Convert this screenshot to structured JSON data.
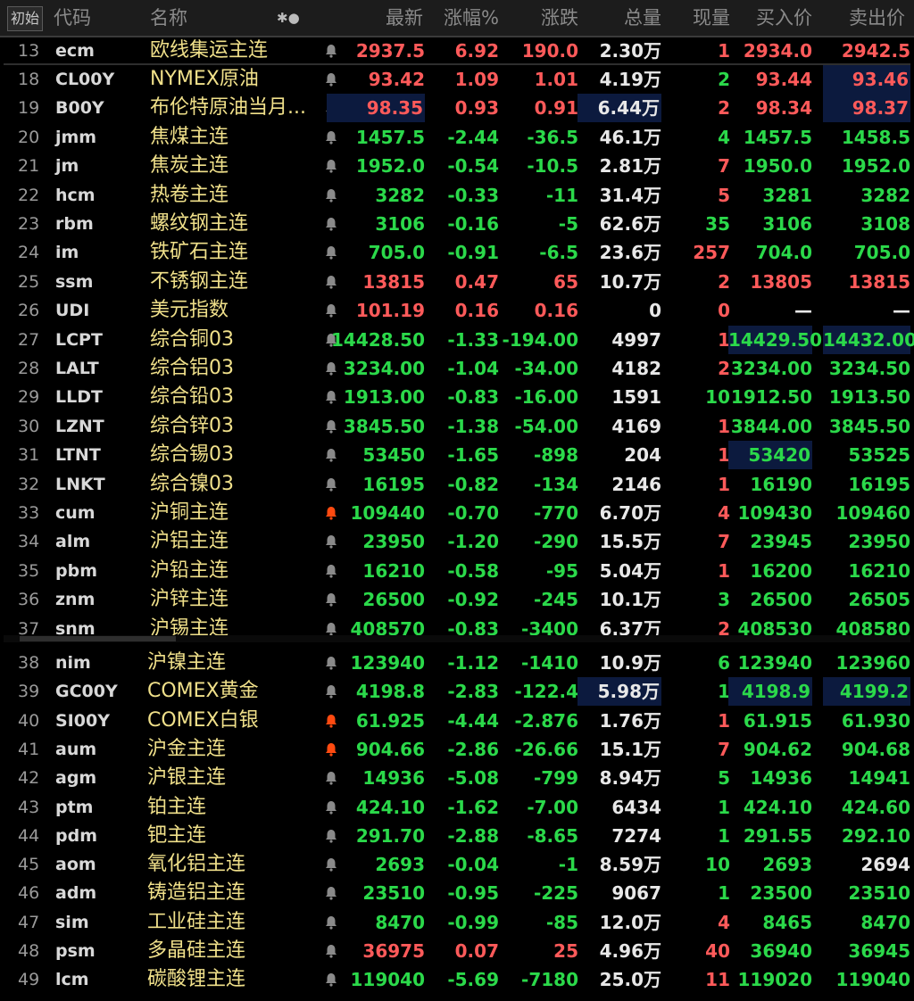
{
  "header": {
    "init_label": "初始",
    "columns": [
      "代码",
      "名称",
      "✱●",
      "最新",
      "涨幅%",
      "涨跌",
      "总量",
      "现量",
      "买入价",
      "卖出价"
    ]
  },
  "colors": {
    "up": "#ff5a5a",
    "down": "#2bd94a",
    "name": "#f0e08a",
    "alert_active": "#ff4a10",
    "alert_idle": "#8a8a8a"
  },
  "rows": [
    {
      "idx": "13",
      "code": "ecm",
      "name": "欧线集运主连",
      "alert": "idle",
      "last": "2937.5",
      "pct": "6.92",
      "chg": "190.0",
      "vol": "2.30万",
      "cur": "1",
      "bid": "2934.0",
      "ask": "2942.5",
      "dir": "up",
      "cur_dir": "up",
      "bid_dir": "up",
      "ask_dir": "up",
      "hl": []
    },
    {
      "idx": "18",
      "code": "CL00Y",
      "name": "NYMEX原油",
      "alert": "idle",
      "last": "93.42",
      "pct": "1.09",
      "chg": "1.01",
      "vol": "4.19万",
      "cur": "2",
      "bid": "93.44",
      "ask": "93.46",
      "dir": "up",
      "cur_dir": "dn",
      "bid_dir": "up",
      "ask_dir": "up",
      "hl": [
        "ask"
      ]
    },
    {
      "idx": "19",
      "code": "B00Y",
      "name": "布伦特原油当月...",
      "alert": "idle",
      "last": "98.35",
      "pct": "0.93",
      "chg": "0.91",
      "vol": "6.44万",
      "cur": "2",
      "bid": "98.34",
      "ask": "98.37",
      "dir": "up",
      "cur_dir": "up",
      "bid_dir": "up",
      "ask_dir": "up",
      "hl": [
        "last",
        "vol",
        "ask"
      ]
    },
    {
      "idx": "20",
      "code": "jmm",
      "name": "焦煤主连",
      "alert": "idle",
      "last": "1457.5",
      "pct": "-2.44",
      "chg": "-36.5",
      "vol": "46.1万",
      "cur": "4",
      "bid": "1457.5",
      "ask": "1458.5",
      "dir": "dn",
      "cur_dir": "dn",
      "bid_dir": "dn",
      "ask_dir": "dn",
      "hl": []
    },
    {
      "idx": "21",
      "code": "jm",
      "name": "焦炭主连",
      "alert": "idle",
      "last": "1952.0",
      "pct": "-0.54",
      "chg": "-10.5",
      "vol": "2.81万",
      "cur": "7",
      "bid": "1950.0",
      "ask": "1952.0",
      "dir": "dn",
      "cur_dir": "up",
      "bid_dir": "dn",
      "ask_dir": "dn",
      "hl": []
    },
    {
      "idx": "22",
      "code": "hcm",
      "name": "热卷主连",
      "alert": "idle",
      "last": "3282",
      "pct": "-0.33",
      "chg": "-11",
      "vol": "31.4万",
      "cur": "5",
      "bid": "3281",
      "ask": "3282",
      "dir": "dn",
      "cur_dir": "up",
      "bid_dir": "dn",
      "ask_dir": "dn",
      "hl": []
    },
    {
      "idx": "23",
      "code": "rbm",
      "name": "螺纹钢主连",
      "alert": "idle",
      "last": "3106",
      "pct": "-0.16",
      "chg": "-5",
      "vol": "62.6万",
      "cur": "35",
      "bid": "3106",
      "ask": "3108",
      "dir": "dn",
      "cur_dir": "dn",
      "bid_dir": "dn",
      "ask_dir": "dn",
      "hl": []
    },
    {
      "idx": "24",
      "code": "im",
      "name": "铁矿石主连",
      "alert": "idle",
      "last": "705.0",
      "pct": "-0.91",
      "chg": "-6.5",
      "vol": "23.6万",
      "cur": "257",
      "bid": "704.0",
      "ask": "705.0",
      "dir": "dn",
      "cur_dir": "up",
      "bid_dir": "dn",
      "ask_dir": "dn",
      "hl": []
    },
    {
      "idx": "25",
      "code": "ssm",
      "name": "不锈钢主连",
      "alert": "idle",
      "last": "13815",
      "pct": "0.47",
      "chg": "65",
      "vol": "10.7万",
      "cur": "2",
      "bid": "13805",
      "ask": "13815",
      "dir": "up",
      "cur_dir": "up",
      "bid_dir": "up",
      "ask_dir": "up",
      "hl": []
    },
    {
      "idx": "26",
      "code": "UDI",
      "name": "美元指数",
      "alert": "idle",
      "last": "101.19",
      "pct": "0.16",
      "chg": "0.16",
      "vol": "0",
      "cur": "0",
      "bid": "—",
      "ask": "—",
      "dir": "up",
      "cur_dir": "up",
      "bid_dir": "ne",
      "ask_dir": "ne",
      "hl": []
    },
    {
      "idx": "27",
      "code": "LCPT",
      "name": "综合铜03",
      "alert": "idle",
      "last": "14428.50",
      "pct": "-1.33",
      "chg": "-194.00",
      "vol": "4997",
      "cur": "1",
      "bid": "14429.50",
      "ask": "14432.00",
      "dir": "dn",
      "cur_dir": "up",
      "bid_dir": "dn",
      "ask_dir": "dn",
      "hl": [
        "bid",
        "ask"
      ]
    },
    {
      "idx": "28",
      "code": "LALT",
      "name": "综合铝03",
      "alert": "idle",
      "last": "3234.00",
      "pct": "-1.04",
      "chg": "-34.00",
      "vol": "4182",
      "cur": "2",
      "bid": "3234.00",
      "ask": "3234.50",
      "dir": "dn",
      "cur_dir": "up",
      "bid_dir": "dn",
      "ask_dir": "dn",
      "hl": []
    },
    {
      "idx": "29",
      "code": "LLDT",
      "name": "综合铅03",
      "alert": "idle",
      "last": "1913.00",
      "pct": "-0.83",
      "chg": "-16.00",
      "vol": "1591",
      "cur": "10",
      "bid": "1912.50",
      "ask": "1913.50",
      "dir": "dn",
      "cur_dir": "dn",
      "bid_dir": "dn",
      "ask_dir": "dn",
      "hl": []
    },
    {
      "idx": "30",
      "code": "LZNT",
      "name": "综合锌03",
      "alert": "idle",
      "last": "3845.50",
      "pct": "-1.38",
      "chg": "-54.00",
      "vol": "4169",
      "cur": "1",
      "bid": "3844.00",
      "ask": "3845.50",
      "dir": "dn",
      "cur_dir": "up",
      "bid_dir": "dn",
      "ask_dir": "dn",
      "hl": []
    },
    {
      "idx": "31",
      "code": "LTNT",
      "name": "综合锡03",
      "alert": "idle",
      "last": "53450",
      "pct": "-1.65",
      "chg": "-898",
      "vol": "204",
      "cur": "1",
      "bid": "53420",
      "ask": "53525",
      "dir": "dn",
      "cur_dir": "up",
      "bid_dir": "dn",
      "ask_dir": "dn",
      "hl": [
        "bid"
      ]
    },
    {
      "idx": "32",
      "code": "LNKT",
      "name": "综合镍03",
      "alert": "idle",
      "last": "16195",
      "pct": "-0.82",
      "chg": "-134",
      "vol": "2146",
      "cur": "1",
      "bid": "16190",
      "ask": "16195",
      "dir": "dn",
      "cur_dir": "up",
      "bid_dir": "dn",
      "ask_dir": "dn",
      "hl": []
    },
    {
      "idx": "33",
      "code": "cum",
      "name": "沪铜主连",
      "alert": "active",
      "last": "109440",
      "pct": "-0.70",
      "chg": "-770",
      "vol": "6.70万",
      "cur": "4",
      "bid": "109430",
      "ask": "109460",
      "dir": "dn",
      "cur_dir": "up",
      "bid_dir": "dn",
      "ask_dir": "dn",
      "hl": []
    },
    {
      "idx": "34",
      "code": "alm",
      "name": "沪铝主连",
      "alert": "idle",
      "last": "23950",
      "pct": "-1.20",
      "chg": "-290",
      "vol": "15.5万",
      "cur": "7",
      "bid": "23945",
      "ask": "23950",
      "dir": "dn",
      "cur_dir": "up",
      "bid_dir": "dn",
      "ask_dir": "dn",
      "hl": []
    },
    {
      "idx": "35",
      "code": "pbm",
      "name": "沪铅主连",
      "alert": "idle",
      "last": "16210",
      "pct": "-0.58",
      "chg": "-95",
      "vol": "5.04万",
      "cur": "1",
      "bid": "16200",
      "ask": "16210",
      "dir": "dn",
      "cur_dir": "up",
      "bid_dir": "dn",
      "ask_dir": "dn",
      "hl": []
    },
    {
      "idx": "36",
      "code": "znm",
      "name": "沪锌主连",
      "alert": "idle",
      "last": "26500",
      "pct": "-0.92",
      "chg": "-245",
      "vol": "10.1万",
      "cur": "3",
      "bid": "26500",
      "ask": "26505",
      "dir": "dn",
      "cur_dir": "dn",
      "bid_dir": "dn",
      "ask_dir": "dn",
      "hl": []
    },
    {
      "idx": "37",
      "code": "snm",
      "name": "沪锡主连",
      "alert": "idle",
      "last": "408570",
      "pct": "-0.83",
      "chg": "-3400",
      "vol": "6.37万",
      "cur": "2",
      "bid": "408530",
      "ask": "408580",
      "dir": "dn",
      "cur_dir": "up",
      "bid_dir": "dn",
      "ask_dir": "dn",
      "hl": []
    },
    {
      "idx": "38",
      "code": "nim",
      "name": "沪镍主连",
      "alert": "idle",
      "last": "123940",
      "pct": "-1.12",
      "chg": "-1410",
      "vol": "10.9万",
      "cur": "6",
      "bid": "123940",
      "ask": "123960",
      "dir": "dn",
      "cur_dir": "dn",
      "bid_dir": "dn",
      "ask_dir": "dn",
      "hl": []
    },
    {
      "idx": "39",
      "code": "GC00Y",
      "name": "COMEX黄金",
      "alert": "idle",
      "last": "4198.8",
      "pct": "-2.83",
      "chg": "-122.4",
      "vol": "5.98万",
      "cur": "1",
      "bid": "4198.9",
      "ask": "4199.2",
      "dir": "dn",
      "cur_dir": "dn",
      "bid_dir": "dn",
      "ask_dir": "dn",
      "hl": [
        "vol",
        "bid",
        "ask"
      ]
    },
    {
      "idx": "40",
      "code": "SI00Y",
      "name": "COMEX白银",
      "alert": "active",
      "last": "61.925",
      "pct": "-4.44",
      "chg": "-2.876",
      "vol": "1.76万",
      "cur": "1",
      "bid": "61.915",
      "ask": "61.930",
      "dir": "dn",
      "cur_dir": "up",
      "bid_dir": "dn",
      "ask_dir": "dn",
      "hl": []
    },
    {
      "idx": "41",
      "code": "aum",
      "name": "沪金主连",
      "alert": "active",
      "last": "904.66",
      "pct": "-2.86",
      "chg": "-26.66",
      "vol": "15.1万",
      "cur": "7",
      "bid": "904.62",
      "ask": "904.68",
      "dir": "dn",
      "cur_dir": "up",
      "bid_dir": "dn",
      "ask_dir": "dn",
      "hl": []
    },
    {
      "idx": "42",
      "code": "agm",
      "name": "沪银主连",
      "alert": "idle",
      "last": "14936",
      "pct": "-5.08",
      "chg": "-799",
      "vol": "8.94万",
      "cur": "5",
      "bid": "14936",
      "ask": "14941",
      "dir": "dn",
      "cur_dir": "dn",
      "bid_dir": "dn",
      "ask_dir": "dn",
      "hl": []
    },
    {
      "idx": "43",
      "code": "ptm",
      "name": "铂主连",
      "alert": "idle",
      "last": "424.10",
      "pct": "-1.62",
      "chg": "-7.00",
      "vol": "6434",
      "cur": "1",
      "bid": "424.10",
      "ask": "424.60",
      "dir": "dn",
      "cur_dir": "dn",
      "bid_dir": "dn",
      "ask_dir": "dn",
      "hl": []
    },
    {
      "idx": "44",
      "code": "pdm",
      "name": "钯主连",
      "alert": "idle",
      "last": "291.70",
      "pct": "-2.88",
      "chg": "-8.65",
      "vol": "7274",
      "cur": "1",
      "bid": "291.55",
      "ask": "292.10",
      "dir": "dn",
      "cur_dir": "dn",
      "bid_dir": "dn",
      "ask_dir": "dn",
      "hl": []
    },
    {
      "idx": "45",
      "code": "aom",
      "name": "氧化铝主连",
      "alert": "idle",
      "last": "2693",
      "pct": "-0.04",
      "chg": "-1",
      "vol": "8.59万",
      "cur": "10",
      "bid": "2693",
      "ask": "2694",
      "dir": "dn",
      "cur_dir": "dn",
      "bid_dir": "dn",
      "ask_dir": "ne",
      "hl": []
    },
    {
      "idx": "46",
      "code": "adm",
      "name": "铸造铝主连",
      "alert": "idle",
      "last": "23510",
      "pct": "-0.95",
      "chg": "-225",
      "vol": "9067",
      "cur": "1",
      "bid": "23500",
      "ask": "23510",
      "dir": "dn",
      "cur_dir": "dn",
      "bid_dir": "dn",
      "ask_dir": "dn",
      "hl": []
    },
    {
      "idx": "47",
      "code": "sim",
      "name": "工业硅主连",
      "alert": "idle",
      "last": "8470",
      "pct": "-0.99",
      "chg": "-85",
      "vol": "12.0万",
      "cur": "4",
      "bid": "8465",
      "ask": "8470",
      "dir": "dn",
      "cur_dir": "up",
      "bid_dir": "dn",
      "ask_dir": "dn",
      "hl": []
    },
    {
      "idx": "48",
      "code": "psm",
      "name": "多晶硅主连",
      "alert": "idle",
      "last": "36975",
      "pct": "0.07",
      "chg": "25",
      "vol": "4.96万",
      "cur": "40",
      "bid": "36940",
      "ask": "36945",
      "dir": "up",
      "cur_dir": "up",
      "bid_dir": "dn",
      "ask_dir": "dn",
      "hl": []
    },
    {
      "idx": "49",
      "code": "lcm",
      "name": "碳酸锂主连",
      "alert": "idle",
      "last": "119040",
      "pct": "-5.69",
      "chg": "-7180",
      "vol": "25.0万",
      "cur": "11",
      "bid": "119020",
      "ask": "119040",
      "dir": "dn",
      "cur_dir": "up",
      "bid_dir": "dn",
      "ask_dir": "dn",
      "hl": []
    }
  ]
}
